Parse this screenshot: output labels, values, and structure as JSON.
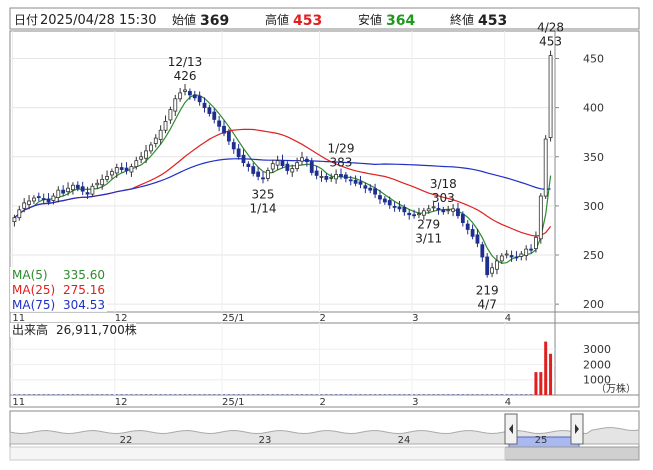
{
  "header": {
    "date_label": "日付",
    "datetime": "2025/04/28 15:30",
    "open_label": "始値",
    "open": "369",
    "high_label": "高値",
    "high": "453",
    "low_label": "安値",
    "low": "364",
    "close_label": "終値",
    "close": "453"
  },
  "chart_data": {
    "type": "candlestick",
    "price_axis": {
      "ticks": [
        200,
        250,
        300,
        350,
        400,
        450
      ],
      "ylim": [
        192,
        478
      ]
    },
    "volume_axis": {
      "ticks": [
        1000,
        2000,
        3000
      ],
      "unit": "（万株）",
      "ylim": [
        0,
        3800
      ]
    },
    "x_month_labels": [
      "11",
      "12",
      "25/1",
      "2",
      "3",
      "4"
    ],
    "nav_labels": [
      "22",
      "23",
      "24",
      "25"
    ],
    "annotations": [
      {
        "label": "12/13",
        "value": "426"
      },
      {
        "label": "1/29",
        "value": "383"
      },
      {
        "label": "325",
        "value": "1/14"
      },
      {
        "label": "3/18",
        "value": "303"
      },
      {
        "label": "279",
        "value": "3/11"
      },
      {
        "label": "219",
        "value": "4/7"
      },
      {
        "label": "4/28",
        "value": "453"
      }
    ],
    "legend": [
      {
        "name": "MA(5)",
        "value": "335.60",
        "color": "#2e8b2e"
      },
      {
        "name": "MA(25)",
        "value": "275.16",
        "color": "#e02020"
      },
      {
        "name": "MA(75)",
        "value": "304.53",
        "color": "#2030c8"
      }
    ],
    "volume_label": "出来高",
    "volume_value": "26,911,700株",
    "closes": [
      288,
      296,
      303,
      305,
      308,
      309,
      307,
      304,
      310,
      316,
      313,
      318,
      321,
      318,
      315,
      312,
      320,
      323,
      327,
      330,
      335,
      339,
      337,
      336,
      340,
      346,
      350,
      356,
      362,
      369,
      377,
      386,
      398,
      409,
      415,
      418,
      413,
      410,
      406,
      400,
      394,
      388,
      381,
      374,
      366,
      358,
      350,
      344,
      340,
      333,
      330,
      328,
      336,
      343,
      346,
      341,
      336,
      338,
      344,
      349,
      345,
      334,
      331,
      330,
      327,
      329,
      332,
      330,
      328,
      326,
      323,
      322,
      318,
      316,
      312,
      307,
      304,
      301,
      299,
      297,
      294,
      291,
      290,
      292,
      295,
      297,
      299,
      296,
      294,
      296,
      297,
      290,
      283,
      276,
      269,
      262,
      248,
      230,
      237,
      244,
      249,
      251,
      248,
      247,
      251,
      256,
      255,
      268,
      310,
      368,
      453
    ],
    "volumes": [
      40,
      40,
      40,
      40,
      40,
      40,
      40,
      40,
      40,
      40,
      40,
      40,
      40,
      40,
      40,
      40,
      40,
      40,
      40,
      40,
      40,
      40,
      40,
      40,
      40,
      40,
      40,
      40,
      40,
      40,
      40,
      40,
      40,
      40,
      40,
      40,
      40,
      40,
      40,
      40,
      40,
      40,
      40,
      40,
      40,
      40,
      40,
      40,
      40,
      40,
      40,
      40,
      40,
      40,
      40,
      40,
      40,
      40,
      40,
      40,
      40,
      40,
      40,
      40,
      40,
      40,
      40,
      40,
      40,
      40,
      40,
      40,
      40,
      40,
      40,
      40,
      40,
      40,
      40,
      40,
      40,
      40,
      40,
      40,
      40,
      40,
      40,
      40,
      40,
      40,
      40,
      40,
      40,
      40,
      40,
      40,
      40,
      40,
      40,
      40,
      40,
      40,
      40,
      40,
      40,
      40,
      40,
      1500,
      1500,
      3500,
      2700
    ]
  }
}
